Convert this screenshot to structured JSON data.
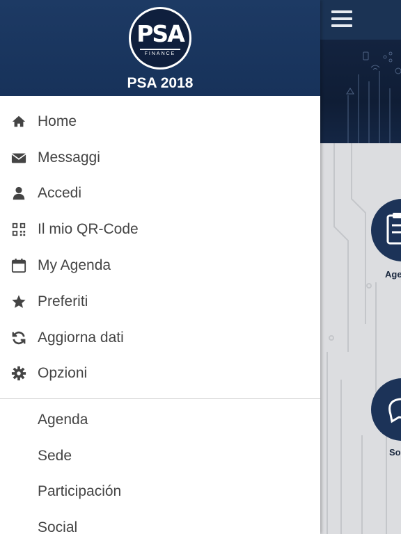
{
  "drawer": {
    "header": {
      "logo_wordmark": "PSA",
      "logo_subtext": "FINANCE",
      "title": "PSA 2018"
    },
    "main_items": [
      {
        "id": "home",
        "label": "Home",
        "icon": "home-icon"
      },
      {
        "id": "messaggi",
        "label": "Messaggi",
        "icon": "envelope-icon"
      },
      {
        "id": "accedi",
        "label": "Accedi",
        "icon": "user-icon"
      },
      {
        "id": "qrcode",
        "label": "Il mio QR-Code",
        "icon": "qrcode-icon"
      },
      {
        "id": "my-agenda",
        "label": "My Agenda",
        "icon": "calendar-icon"
      },
      {
        "id": "preferiti",
        "label": "Preferiti",
        "icon": "star-icon"
      },
      {
        "id": "aggiorna",
        "label": "Aggiorna dati",
        "icon": "refresh-icon"
      },
      {
        "id": "opzioni",
        "label": "Opzioni",
        "icon": "gear-icon"
      }
    ],
    "sub_items": [
      {
        "id": "agenda",
        "label": "Agenda"
      },
      {
        "id": "sede",
        "label": "Sede"
      },
      {
        "id": "participacion",
        "label": "Participación"
      },
      {
        "id": "social",
        "label": "Social"
      }
    ]
  },
  "background": {
    "tiles": [
      {
        "label": "Age",
        "icon": "clipboard-icon"
      },
      {
        "label": "So",
        "icon": "chat-icon"
      }
    ]
  },
  "colors": {
    "header_bg": "#1d3a64",
    "topbar_bg": "#1b3354",
    "icon": "#444444",
    "text": "#444444"
  }
}
